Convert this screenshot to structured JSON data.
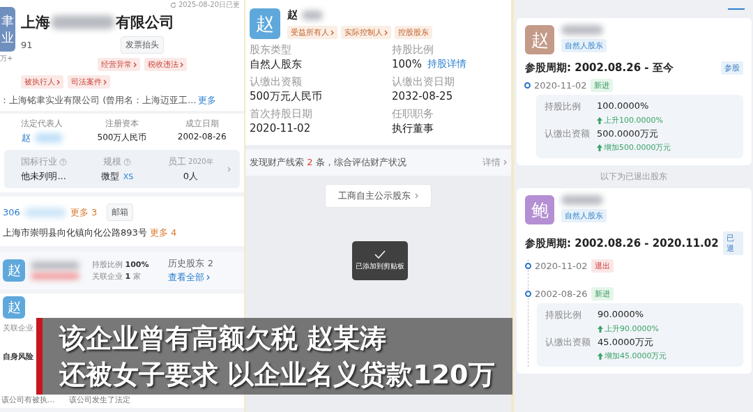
{
  "left": {
    "update_note": "2025-08-20日已更",
    "logo": [
      "聿",
      "业"
    ],
    "logo_caption": "万+",
    "name_start": "上海",
    "name_end": "有限公司",
    "code_prefix": "91",
    "invoice_button": "发票抬头",
    "tags": [
      {
        "label": "经营异常",
        "arrow": true
      },
      {
        "label": "税收违法",
        "arrow": true
      },
      {
        "label": "被执行人",
        "arrow": true
      },
      {
        "label": "司法案件",
        "arrow": true
      }
    ],
    "former_name": "：上海铭聿实业有限公司 (曾用名：上海迈亚工...",
    "former_more": "更多",
    "facts": [
      {
        "label": "法定代表人",
        "value": "赵",
        "kind": "person"
      },
      {
        "label": "注册资本",
        "value": "500万人民币",
        "kind": "text"
      },
      {
        "label": "成立日期",
        "value": "2002-08-26",
        "kind": "text"
      }
    ],
    "stats": [
      {
        "label": "国标行业",
        "info": true,
        "value": "他未列明..."
      },
      {
        "label": "规模",
        "info": true,
        "value": "微型",
        "badge": "XS"
      },
      {
        "label": "员工",
        "info": false,
        "note": "2020年",
        "value": "0人"
      }
    ],
    "phone": "306",
    "phone_more": "更多 3",
    "email_button": "邮箱",
    "address": "上海市崇明县向化镇向化公路893号",
    "address_more": "更多 4",
    "shareholder": {
      "avatar": "赵",
      "ratio_label": "持股比例",
      "ratio": "100%",
      "related_label": "关联企业",
      "related_count": "1",
      "related_unit": "家",
      "history_label": "历史股东",
      "history_count": "2",
      "view_all": "查看全部"
    },
    "partial": {
      "avatar": "赵",
      "related": "关联企业",
      "risk": "自身风险",
      "notes": [
        "该公司有被执...",
        "该公司发生了法定"
      ]
    }
  },
  "middle": {
    "avatar": "赵",
    "name": "赵",
    "tags": [
      {
        "label": "受益所有人",
        "arrow": true
      },
      {
        "label": "实际控制人",
        "arrow": true
      },
      {
        "label": "控股股东",
        "arrow": false
      }
    ],
    "fields": [
      {
        "label": "股东类型",
        "value": "自然人股东"
      },
      {
        "label": "持股比例",
        "value": "100%",
        "link": "持股详情"
      },
      {
        "label": "认缴出资额",
        "value": "500万元人民币"
      },
      {
        "label": "认缴出资日期",
        "value": "2032-08-25"
      },
      {
        "label": "首次持股日期",
        "value": "2020-11-02"
      },
      {
        "label": "任职职务",
        "value": "执行董事"
      }
    ],
    "clue_before": "发现财产线索",
    "clue_count": "2",
    "clue_after": "条，综合评估财产状况",
    "detail": "详情",
    "public_button": "工商自主公示股东",
    "toast": "已添加到剪贴板"
  },
  "right": {
    "shareholders": [
      {
        "avatar": "赵",
        "color": "#c49a88",
        "type": "自然人股东",
        "period": "参股周期: 2002.08.26 - 至今",
        "status": "参股",
        "events": [
          {
            "date": "2020-11-02",
            "kind": "in",
            "tag": "新进",
            "changes": [
              {
                "label": "持股比例",
                "value": "100.0000%",
                "delta": "上升100.0000%"
              },
              {
                "label": "认缴出资额",
                "value": "500.0000万元",
                "delta": "增加500.0000万元"
              }
            ]
          }
        ]
      },
      {
        "avatar": "鲍",
        "color": "#b48fd3",
        "type": "自然人股东",
        "period": "参股周期: 2002.08.26 - 2020.11.02",
        "status": "已退",
        "events": [
          {
            "date": "2020-11-02",
            "kind": "out",
            "tag": "退出"
          },
          {
            "date": "2002-08-26",
            "kind": "in",
            "tag": "新进",
            "changes": [
              {
                "label": "持股比例",
                "value": "90.0000%",
                "delta": "上升90.0000%"
              },
              {
                "label": "认缴出资额",
                "value": "45.0000万元",
                "delta": "增加45.0000万元"
              }
            ]
          }
        ]
      }
    ],
    "divider": "以下为已退出股东"
  },
  "caption": {
    "lines": [
      "该企业曾有高额欠税 赵某涛",
      "还被女子要求 以企业名义贷款120万"
    ]
  }
}
